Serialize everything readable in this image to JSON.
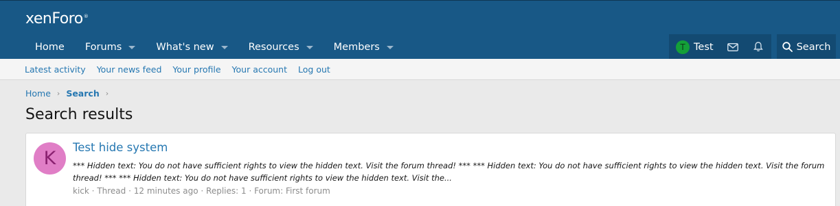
{
  "header": {
    "logo": "xenForo",
    "logo_mark": "®",
    "nav": [
      {
        "label": "Home",
        "caret": false
      },
      {
        "label": "Forums",
        "caret": true
      },
      {
        "label": "What's new",
        "caret": true
      },
      {
        "label": "Resources",
        "caret": true
      },
      {
        "label": "Members",
        "caret": true
      }
    ],
    "user": {
      "avatar_letter": "T",
      "name": "Test"
    },
    "search_label": "Search"
  },
  "subnav": [
    "Latest activity",
    "Your news feed",
    "Your profile",
    "Your account",
    "Log out"
  ],
  "breadcrumb": {
    "home": "Home",
    "current": "Search"
  },
  "page_title": "Search results",
  "results": [
    {
      "avatar_letter": "K",
      "title": "Test hide system",
      "snippet": "*** Hidden text: You do not have sufficient rights to view the hidden text. Visit the forum thread! *** *** Hidden text: You do not have sufficient rights to view the hidden text. Visit the forum thread! *** *** Hidden text: You do not have sufficient rights to view the hidden text. Visit the...",
      "meta": {
        "author": "kick",
        "type": "Thread",
        "time": "12 minutes ago",
        "replies": "Replies: 1",
        "forum": "Forum: First forum"
      }
    }
  ],
  "colors": {
    "header_bg": "#185886",
    "link": "#2577b1",
    "avatar_k": "#e07ec6",
    "avatar_t": "#14a038"
  }
}
